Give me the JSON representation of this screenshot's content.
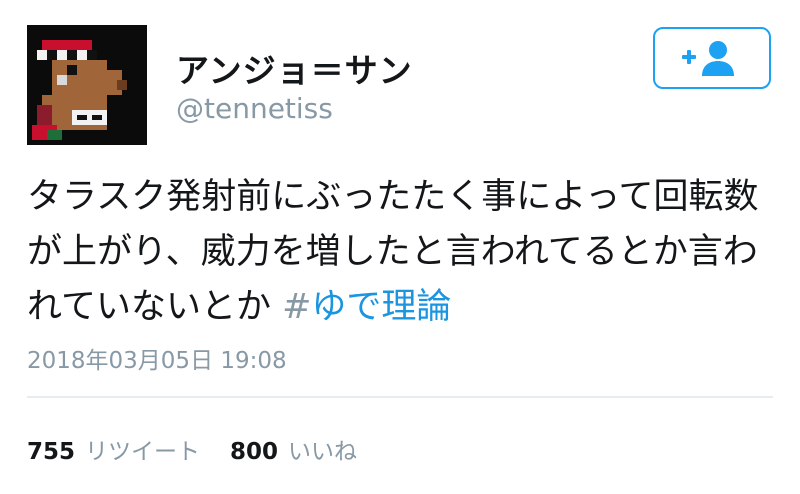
{
  "user": {
    "display_name": "アンジョ＝サン",
    "handle": "@tennetiss",
    "avatar_icon": "pixel-art-avatar"
  },
  "follow_button": {
    "icon": "add-user-icon",
    "accent": "#1da1f2"
  },
  "tweet": {
    "text": "タラスク発射前にぶったたく事によって回転数が上がり、威力を増したと言われてるとか言われていないとか ",
    "hashtag_sign": "#",
    "hashtag": "ゆで理論",
    "hashtag_color": "#1b95e0",
    "timestamp": "2018年03月05日 19:08"
  },
  "stats": {
    "retweets_count": "755",
    "retweets_label": "リツイート",
    "likes_count": "800",
    "likes_label": "いいね"
  }
}
